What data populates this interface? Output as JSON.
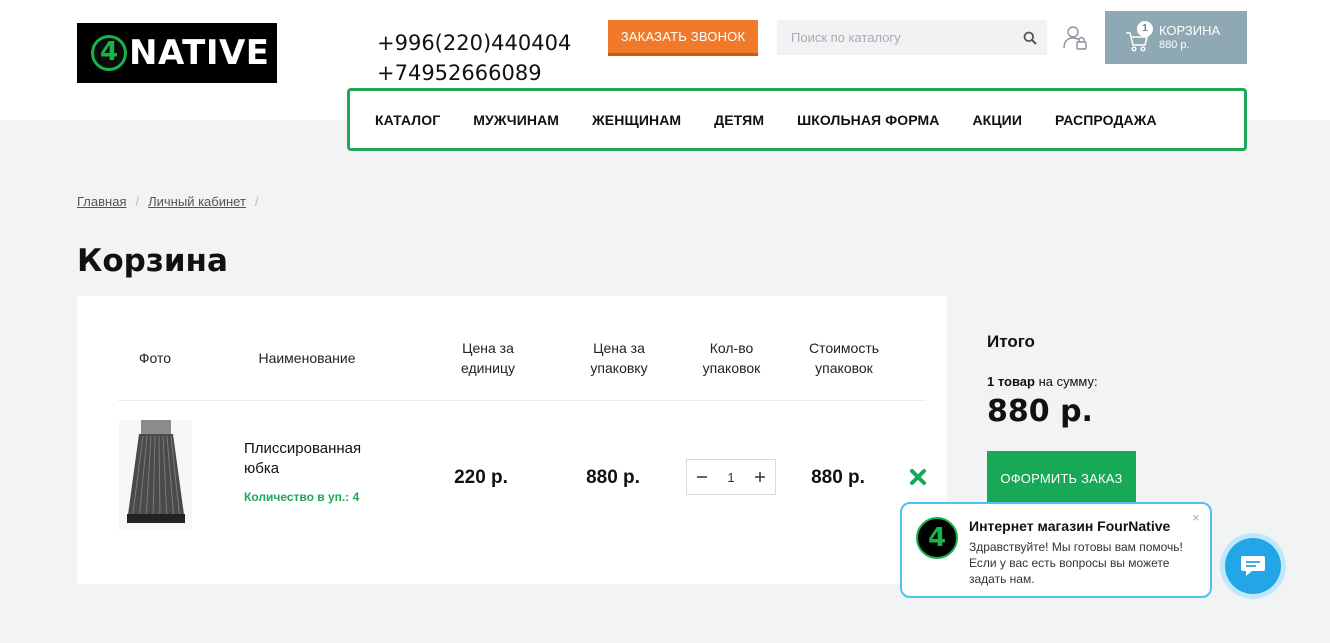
{
  "header": {
    "logo_text": "NATIVE",
    "logo_mark": "4",
    "phones": [
      "+996(220)440404",
      "+74952666089"
    ],
    "callback_button": "ЗАКАЗАТЬ ЗВОНОК",
    "search_placeholder": "Поиск по каталогу",
    "cart": {
      "count": "1",
      "label": "КОРЗИНА",
      "sum": "880 р."
    }
  },
  "nav": {
    "items": [
      "КАТАЛОГ",
      "МУЖЧИНАМ",
      "ЖЕНЩИНАМ",
      "ДЕТЯМ",
      "ШКОЛЬНАЯ ФОРМА",
      "АКЦИИ",
      "РАСПРОДАЖА"
    ]
  },
  "breadcrumb": {
    "items": [
      "Главная",
      "Личный кабинет"
    ],
    "separator": "/"
  },
  "page_title": "Корзина",
  "table": {
    "headers": {
      "photo": "Фото",
      "name": "Наименование",
      "unit_price_1": "Цена за",
      "unit_price_2": "единицу",
      "pack_price_1": "Цена за",
      "pack_price_2": "упаковку",
      "qty_1": "Кол-во",
      "qty_2": "упаковок",
      "total_1": "Стоимость",
      "total_2": "упаковок"
    },
    "rows": [
      {
        "name": "Плиссированная юбка",
        "pack_info": "Количество в уп.: 4",
        "unit_price": "220 р.",
        "pack_price": "880 р.",
        "quantity": "1",
        "total": "880 р."
      }
    ]
  },
  "summary": {
    "title": "Итого",
    "count_bold": "1 товар",
    "count_rest": " на сумму:",
    "total": "880 р.",
    "checkout_button": "ОФОРМИТЬ ЗАКАЗ"
  },
  "chat": {
    "name": "Интернет магазин FourNative",
    "message": "Здравствуйте! Мы готовы вам помочь! Если у вас есть вопросы вы можете задать нам.",
    "close": "×"
  },
  "colors": {
    "accent_green": "#1fa85a",
    "callback_orange": "#f07a2a",
    "cart_bg": "#8ea8b4",
    "chat_blue": "#23a6e8"
  }
}
